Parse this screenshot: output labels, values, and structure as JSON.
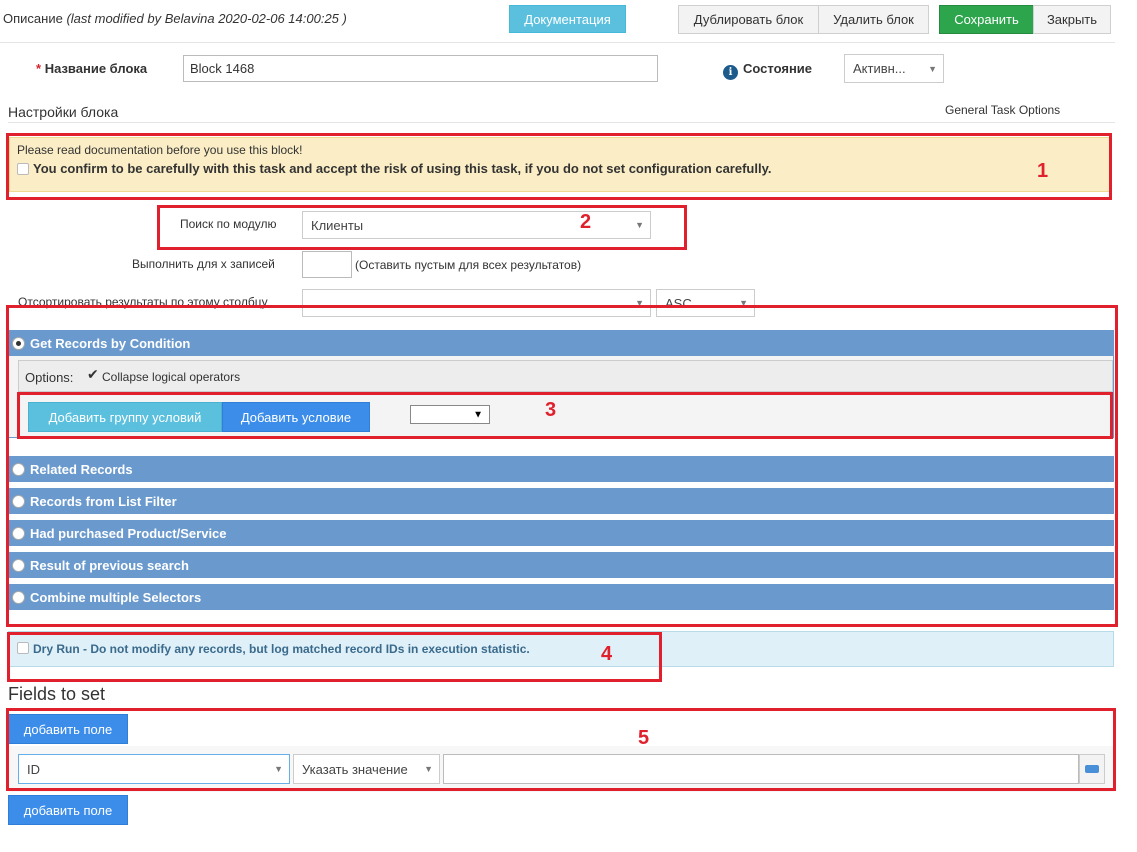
{
  "header": {
    "title": "Описание",
    "subtitle": "(last modified by Belavina 2020-02-06 14:00:25 )",
    "docs_button": "Документация",
    "duplicate_button": "Дублировать блок",
    "delete_button": "Удалить блок",
    "save_button": "Сохранить",
    "close_button": "Закрыть"
  },
  "block": {
    "name_label": "Название блока",
    "required_mark": "*",
    "name_value": "Block 1468",
    "state_label": "Состояние",
    "state_value": "Активн..."
  },
  "settings": {
    "title": "Настройки блока",
    "general_options": "General Task Options"
  },
  "warning": {
    "line1": "Please read documentation before you use this block!",
    "confirm": "You confirm to be carefully with this task and accept the risk of using this task, if you do not set configuration carefully."
  },
  "search": {
    "module_label": "Поиск по модулю",
    "module_value": "Клиенты",
    "limit_label": "Выполнить для x записей",
    "limit_value": "",
    "limit_hint": "(Оставить пустым для всех результатов)",
    "sort_label": "Отсортировать результаты по этому столбцу",
    "sort_value": "",
    "order_value": "ASC"
  },
  "selectors": {
    "get_by_condition": "Get Records by Condition",
    "options_label": "Options:",
    "collapse_label": "Collapse logical operators",
    "add_group_button": "Добавить группу условий",
    "add_condition_button": "Добавить условие",
    "operator_value": "",
    "related": "Related Records",
    "list_filter": "Records from List Filter",
    "purchased": "Had purchased Product/Service",
    "previous": "Result of previous search",
    "combine": "Combine multiple Selectors"
  },
  "dryrun": {
    "label": "Dry Run - Do not modify any records, but log matched record IDs in execution statistic."
  },
  "fields": {
    "title": "Fields to set",
    "add_field_button": "добавить поле",
    "field_value": "ID",
    "mode_value": "Указать значение",
    "value": "",
    "add_field_button_bottom": "добавить поле"
  },
  "annotations": {
    "n1": "1",
    "n2": "2",
    "n3": "3",
    "n4": "4",
    "n5": "5"
  },
  "colors": {
    "annotation": "#e0202c",
    "section_bar": "#6a99cd",
    "save": "#2da54c",
    "primary": "#3c8dea"
  }
}
